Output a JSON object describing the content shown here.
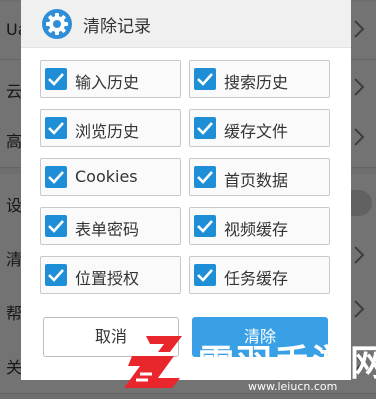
{
  "background_rows": [
    {
      "label": "Ua",
      "control": "chevron"
    },
    {
      "label": "云",
      "control": "chevron"
    },
    {
      "label": "高",
      "control": "chevron"
    },
    {
      "label": "设",
      "control": "toggle"
    },
    {
      "label": "清",
      "control": "chevron"
    },
    {
      "label": "帮",
      "control": "chevron"
    },
    {
      "label": "关",
      "control": "chevron"
    }
  ],
  "dialog": {
    "title": "清除记录",
    "icon": "gear-icon",
    "options": [
      {
        "label": "输入历史",
        "checked": true
      },
      {
        "label": "搜索历史",
        "checked": true
      },
      {
        "label": "浏览历史",
        "checked": true
      },
      {
        "label": "缓存文件",
        "checked": true
      },
      {
        "label": "Cookies",
        "checked": true
      },
      {
        "label": "首页数据",
        "checked": true
      },
      {
        "label": "表单密码",
        "checked": true
      },
      {
        "label": "视频缓存",
        "checked": true
      },
      {
        "label": "位置授权",
        "checked": true
      },
      {
        "label": "任务缓存",
        "checked": true
      }
    ],
    "cancel_label": "取消",
    "clear_label": "清除"
  },
  "watermark": {
    "name": "雷羽手游网",
    "url": "www.leiucn.com"
  },
  "colors": {
    "accent": "#1e8fd6",
    "button_primary": "#3aa0e6",
    "logo_red": "#e8262c"
  }
}
